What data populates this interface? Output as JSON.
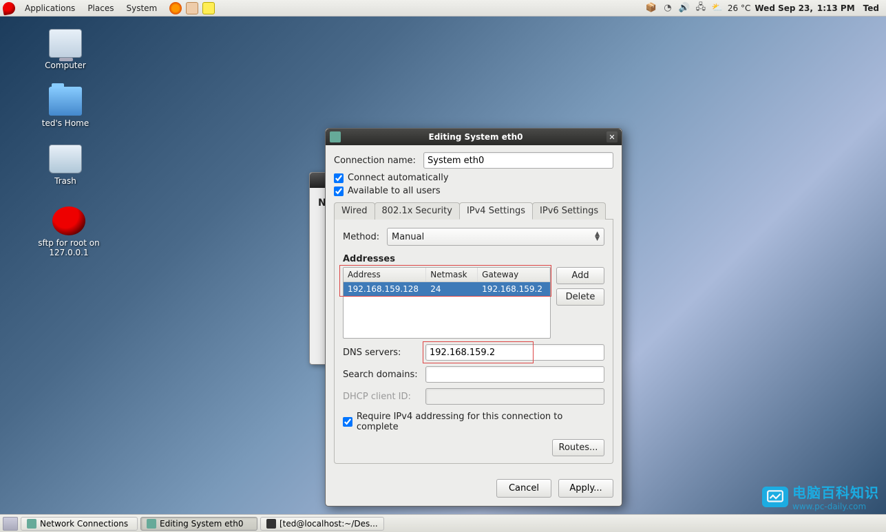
{
  "menubar": {
    "applications": "Applications",
    "places": "Places",
    "system": "System",
    "weather": "26 °C",
    "date": "Wed Sep 23,",
    "time": "1:13 PM",
    "user": "Ted"
  },
  "desktop": {
    "computer": "Computer",
    "home": "ted's Home",
    "trash": "Trash",
    "sftp": "sftp for root on 127.0.0.1"
  },
  "dialog": {
    "title": "Editing System eth0",
    "connection_name_label": "Connection name:",
    "connection_name": "System eth0",
    "connect_auto": "Connect automatically",
    "available_all": "Available to all users",
    "tabs": {
      "wired": "Wired",
      "security": "802.1x Security",
      "ipv4": "IPv4 Settings",
      "ipv6": "IPv6 Settings"
    },
    "method_label": "Method:",
    "method_value": "Manual",
    "addresses_label": "Addresses",
    "table": {
      "h_address": "Address",
      "h_netmask": "Netmask",
      "h_gateway": "Gateway",
      "address": "192.168.159.128",
      "netmask": "24",
      "gateway": "192.168.159.2"
    },
    "add_btn": "Add",
    "delete_btn": "Delete",
    "dns_label": "DNS servers:",
    "dns_value": "192.168.159.2",
    "search_label": "Search domains:",
    "search_value": "",
    "dhcp_label": "DHCP client ID:",
    "dhcp_value": "",
    "require_ipv4": "Require IPv4 addressing for this connection to complete",
    "routes_btn": "Routes...",
    "cancel_btn": "Cancel",
    "apply_btn": "Apply..."
  },
  "taskbar": {
    "nc": "Network Connections",
    "edit": "Editing System eth0",
    "term": "[ted@localhost:~/Des..."
  },
  "bg_window_letter": "N",
  "watermark": {
    "zh": "电脑百科知识",
    "en": "www.pc-daily.com"
  }
}
